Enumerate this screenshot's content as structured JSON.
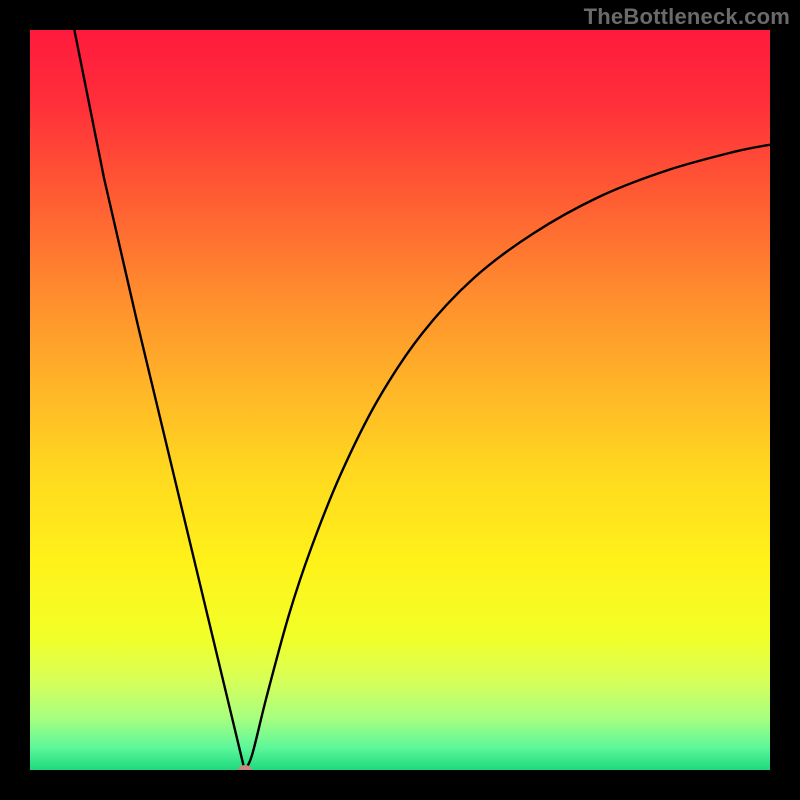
{
  "watermark": "TheBottleneck.com",
  "chart_data": {
    "type": "line",
    "title": "",
    "xlabel": "",
    "ylabel": "",
    "x_range": [
      0,
      100
    ],
    "y_range": [
      0,
      100
    ],
    "grid": false,
    "legend": false,
    "series": [
      {
        "name": "bottleneck-curve",
        "color": "#000000",
        "points": [
          {
            "x": 6.0,
            "y": 100.0
          },
          {
            "x": 8.0,
            "y": 90.0
          },
          {
            "x": 10.0,
            "y": 80.0
          },
          {
            "x": 12.3,
            "y": 70.0
          },
          {
            "x": 14.6,
            "y": 60.0
          },
          {
            "x": 17.0,
            "y": 50.0
          },
          {
            "x": 19.4,
            "y": 40.0
          },
          {
            "x": 21.8,
            "y": 30.0
          },
          {
            "x": 24.2,
            "y": 20.0
          },
          {
            "x": 26.6,
            "y": 10.0
          },
          {
            "x": 29.0,
            "y": 0.0
          },
          {
            "x": 30.0,
            "y": 2.0
          },
          {
            "x": 32.0,
            "y": 10.0
          },
          {
            "x": 35.0,
            "y": 21.0
          },
          {
            "x": 38.0,
            "y": 30.0
          },
          {
            "x": 42.0,
            "y": 40.0
          },
          {
            "x": 47.0,
            "y": 50.0
          },
          {
            "x": 53.0,
            "y": 59.0
          },
          {
            "x": 60.0,
            "y": 66.5
          },
          {
            "x": 68.0,
            "y": 72.5
          },
          {
            "x": 77.0,
            "y": 77.5
          },
          {
            "x": 86.0,
            "y": 81.0
          },
          {
            "x": 95.0,
            "y": 83.5
          },
          {
            "x": 100.0,
            "y": 84.5
          }
        ]
      }
    ],
    "marker": {
      "x": 29.0,
      "y": 0.0,
      "color": "#c98a7d"
    },
    "background_gradient": {
      "stops": [
        {
          "offset": 0.0,
          "color": "#ff1a3d"
        },
        {
          "offset": 0.1,
          "color": "#ff2f3a"
        },
        {
          "offset": 0.22,
          "color": "#ff5a33"
        },
        {
          "offset": 0.35,
          "color": "#ff8a2e"
        },
        {
          "offset": 0.48,
          "color": "#ffb428"
        },
        {
          "offset": 0.6,
          "color": "#ffd91f"
        },
        {
          "offset": 0.72,
          "color": "#fff21a"
        },
        {
          "offset": 0.82,
          "color": "#f2ff28"
        },
        {
          "offset": 0.88,
          "color": "#d6ff59"
        },
        {
          "offset": 0.93,
          "color": "#a7ff80"
        },
        {
          "offset": 0.97,
          "color": "#5cf79a"
        },
        {
          "offset": 1.0,
          "color": "#1ed97d"
        }
      ]
    }
  }
}
